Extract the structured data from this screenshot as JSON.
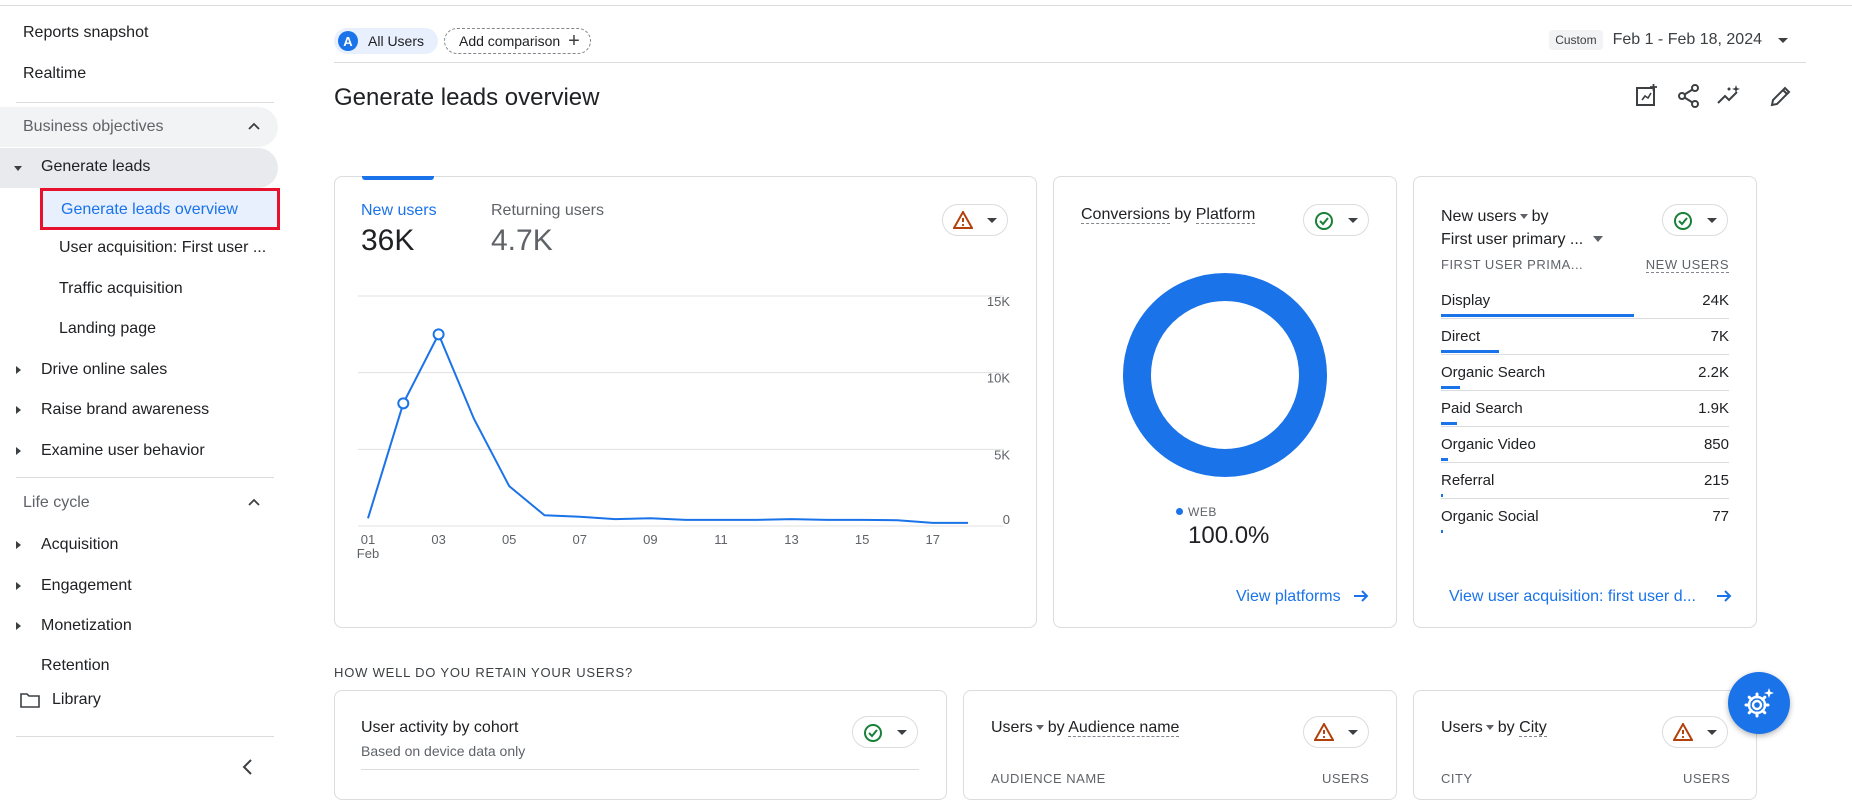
{
  "sidebar": {
    "top_items": [
      "Reports snapshot",
      "Realtime"
    ],
    "business_objectives": "Business objectives",
    "generate_leads": "Generate leads",
    "generate_leads_children": [
      "Generate leads overview",
      "User acquisition: First user ...",
      "Traffic acquisition",
      "Landing page"
    ],
    "objectives": [
      "Drive online sales",
      "Raise brand awareness",
      "Examine user behavior"
    ],
    "life_cycle": "Life cycle",
    "life_cycle_items": [
      "Acquisition",
      "Engagement",
      "Monetization",
      "Retention"
    ],
    "library": "Library"
  },
  "toolbar": {
    "all_users_avatar": "A",
    "all_users": "All Users",
    "add_comparison": "Add comparison",
    "date_tag": "Custom",
    "date_range": "Feb 1 - Feb 18, 2024"
  },
  "page": {
    "title": "Generate leads overview"
  },
  "users_card": {
    "tab_new": "New users",
    "value_new": "36K",
    "tab_returning": "Returning users",
    "value_returning": "4.7K",
    "chart_data": {
      "type": "line",
      "x": [
        1,
        2,
        3,
        4,
        5,
        6,
        7,
        8,
        9,
        10,
        11,
        12,
        13,
        14,
        15,
        16,
        17,
        18
      ],
      "x_tick_labels": [
        "01",
        "03",
        "05",
        "07",
        "09",
        "11",
        "13",
        "15",
        "17"
      ],
      "x_sub_label": "Feb",
      "y_tick_labels": [
        "15K",
        "10K",
        "5K",
        "0"
      ],
      "ylim": [
        0,
        15000
      ],
      "series": [
        {
          "values": [
            500,
            8000,
            12500,
            7000,
            2600,
            700,
            600,
            450,
            500,
            400,
            400,
            400,
            450,
            400,
            400,
            380,
            200,
            200
          ]
        }
      ],
      "grid": true
    }
  },
  "conversions_card": {
    "title_a": "Conversions",
    "title_by": "by",
    "title_b": "Platform",
    "legend": "WEB",
    "value": "100.0%",
    "link": "View platforms",
    "chart_data": {
      "type": "pie",
      "categories": [
        "WEB"
      ],
      "values": [
        100.0
      ]
    }
  },
  "acquisition_card": {
    "title_a": "New users",
    "title_by": "by",
    "title_b": "First user primary ...",
    "col_1": "FIRST USER PRIMA...",
    "col_2": "NEW USERS",
    "rows": [
      {
        "name": "Display",
        "value": "24K",
        "fraction": 0.67
      },
      {
        "name": "Direct",
        "value": "7K",
        "fraction": 0.2
      },
      {
        "name": "Organic Search",
        "value": "2.2K",
        "fraction": 0.065
      },
      {
        "name": "Paid Search",
        "value": "1.9K",
        "fraction": 0.055
      },
      {
        "name": "Organic Video",
        "value": "850",
        "fraction": 0.025
      },
      {
        "name": "Referral",
        "value": "215",
        "fraction": 0.008
      },
      {
        "name": "Organic Social",
        "value": "77",
        "fraction": 0.004
      }
    ],
    "link": "View user acquisition: first user d..."
  },
  "retention": {
    "heading": "HOW WELL DO YOU RETAIN YOUR USERS?"
  },
  "cohort_card": {
    "title": "User activity by cohort",
    "subtitle": "Based on device data only"
  },
  "audience_card": {
    "title_a": "Users",
    "title_by": "by",
    "title_b": "Audience name",
    "col_1": "AUDIENCE NAME",
    "col_2": "USERS"
  },
  "city_card": {
    "title_a": "Users",
    "title_by": "by",
    "title_b": "City",
    "col_1": "CITY",
    "col_2": "USERS"
  },
  "colors": {
    "accent": "#1a73e8",
    "warning": "#b3410b",
    "ok": "#188038",
    "highlight": "#e8112d"
  },
  "icons": [
    "customize-report-icon",
    "share-icon",
    "insights-icon",
    "edit-icon",
    "folder-icon",
    "collapse-sidebar-icon",
    "settings-sparkle-icon"
  ]
}
